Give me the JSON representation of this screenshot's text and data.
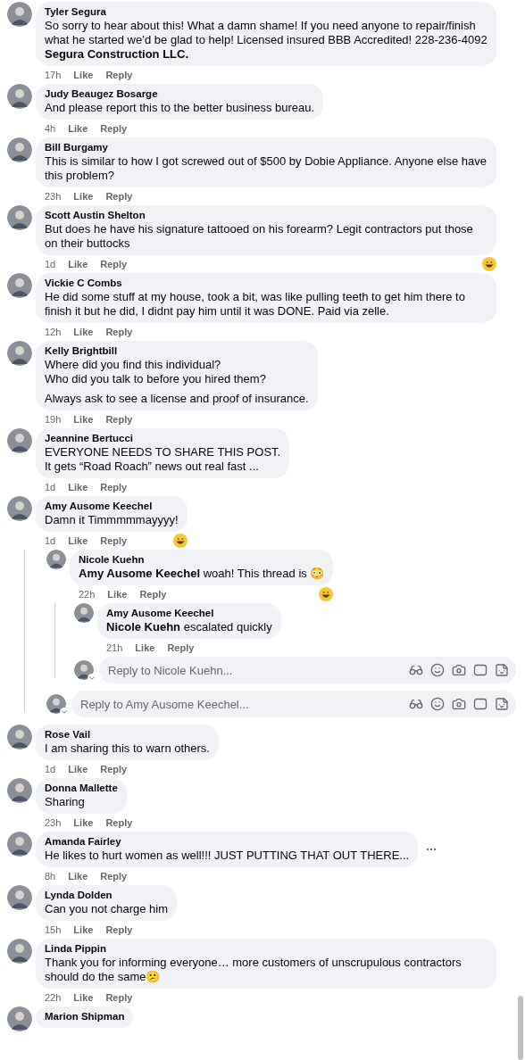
{
  "comments": [
    {
      "author": "Tyler Segura",
      "paragraphs": [
        "So sorry to hear about this! What a damn shame! If you need anyone to repair/finish what he started we’d be glad to help! Licensed insured BBB Accredited! 228-236-4092 **Segura Construction LLC.**"
      ],
      "time": "17h",
      "like": "Like",
      "reply": "Reply"
    },
    {
      "author": "Judy Beaugez Bosarge",
      "paragraphs": [
        "And please report this to the better business bureau."
      ],
      "time": "4h",
      "like": "Like",
      "reply": "Reply"
    },
    {
      "author": "Bill Burgamy",
      "paragraphs": [
        "This is similar to how I got screwed out of $500 by Dobie Appliance. Anyone else have this problem?"
      ],
      "time": "23h",
      "like": "Like",
      "reply": "Reply"
    },
    {
      "author": "Scott Austin Shelton",
      "paragraphs": [
        "But does he have his signature tattooed on his forearm? Legit contractors put those on their buttocks"
      ],
      "time": "1d",
      "like": "Like",
      "reply": "Reply",
      "reaction": true
    },
    {
      "author": "Vickie C Combs",
      "paragraphs": [
        "He did some stuff at my house, took a bit, was like pulling teeth to get him there to finish it but he did, I didnt pay him until it was DONE. Paid via zelle."
      ],
      "time": "12h",
      "like": "Like",
      "reply": "Reply"
    },
    {
      "author": "Kelly Brightbill",
      "paragraphs": [
        "Where did you find this individual?\nWho did you talk to before you hired them?",
        "Always ask to see a license and proof of insurance."
      ],
      "time": "19h",
      "like": "Like",
      "reply": "Reply"
    },
    {
      "author": "Jeannine Bertucci",
      "paragraphs": [
        "EVERYONE NEEDS TO SHARE THIS POST.\nIt gets “Road Roach” news out real fast ..."
      ],
      "time": "1d",
      "like": "Like",
      "reply": "Reply"
    },
    {
      "author": "Amy Ausome Keechel",
      "paragraphs": [
        "Damn it Timmmmmayyyy!"
      ],
      "time": "1d",
      "like": "Like",
      "reply": "Reply",
      "reaction": true,
      "replies": [
        {
          "author": "Nicole Kuehn",
          "paragraphs": [
            "**Amy Ausome Keechel** woah! This thread is 😳"
          ],
          "time": "22h",
          "like": "Like",
          "reply": "Reply",
          "reaction": true,
          "replies": [
            {
              "author": "Amy Ausome Keechel",
              "paragraphs": [
                "**Nicole Kuehn** escalated quickly"
              ],
              "time": "21h",
              "like": "Like",
              "reply": "Reply"
            }
          ],
          "reply_box": {
            "placeholder": "Reply to Nicole Kuehn..."
          }
        }
      ],
      "reply_box": {
        "placeholder": "Reply to Amy Ausome Keechel..."
      }
    },
    {
      "author": "Rose Vail",
      "paragraphs": [
        "I am sharing this to warn others."
      ],
      "time": "1d",
      "like": "Like",
      "reply": "Reply"
    },
    {
      "author": "Donna Mallette",
      "paragraphs": [
        "Sharing"
      ],
      "time": "23h",
      "like": "Like",
      "reply": "Reply"
    },
    {
      "author": "Amanda Fairley",
      "paragraphs": [
        "He likes to hurt women as well!!! JUST PUTTING THAT OUT THERE..."
      ],
      "time": "8h",
      "like": "Like",
      "reply": "Reply",
      "more_button": true
    },
    {
      "author": "Lynda Dolden",
      "paragraphs": [
        "Can you not charge him"
      ],
      "time": "15h",
      "like": "Like",
      "reply": "Reply"
    },
    {
      "author": "Linda Pippin",
      "paragraphs": [
        "Thank you for informing everyone… more customers of unscrupulous contractors should do the same😕"
      ],
      "time": "22h",
      "like": "Like",
      "reply": "Reply"
    },
    {
      "author": "Marion Shipman"
    }
  ]
}
